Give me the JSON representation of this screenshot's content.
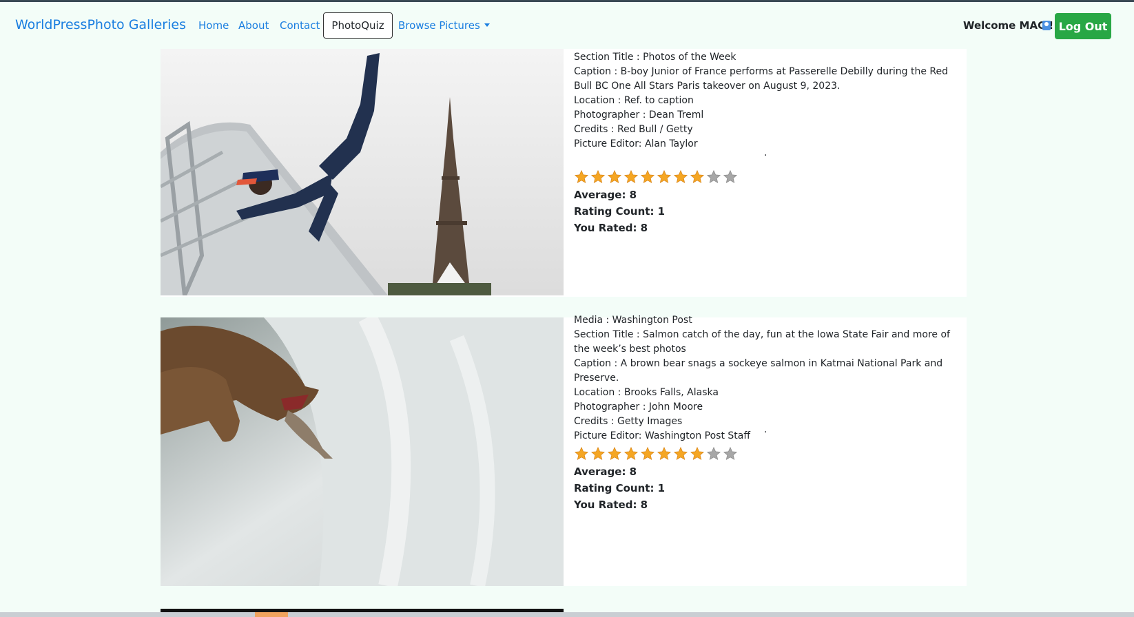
{
  "nav": {
    "brand": "WorldPressPhoto Galleries",
    "home": "Home",
    "about": "About",
    "contact": "Contact",
    "quiz": "PhotoQuiz",
    "browse": "Browse Pictures",
    "welcome": "Welcome MAC !",
    "logout": "Log Out"
  },
  "cards": [
    {
      "lines": [
        "Section Title : Photos of the Week",
        "Caption : B-boy Junior of France performs at Passerelle Debilly during the Red Bull BC One All Stars Paris takeover on August 9, 2023.",
        "Location : Ref. to caption",
        "Photographer : Dean Treml",
        "Credits : Red Bull / Getty",
        "Picture Editor: Alan Taylor"
      ],
      "rating": 8,
      "max_rating": 10,
      "average": "Average: 8",
      "count": "Rating Count: 1",
      "rated": "You Rated: 8"
    },
    {
      "lines": [
        "Media : Washington Post",
        "Section Title : Salmon catch of the day, fun at the Iowa State Fair and more of the week’s best photos",
        "Caption : A brown bear snags a sockeye salmon in Katmai National Park and Preserve.",
        "Location : Brooks Falls, Alaska",
        "Photographer : John Moore",
        "Credits : Getty Images",
        "Picture Editor: Washington Post Staff"
      ],
      "rating": 8,
      "max_rating": 10,
      "average": "Average: 8",
      "count": "Rating Count: 1",
      "rated": "You Rated: 8"
    }
  ]
}
